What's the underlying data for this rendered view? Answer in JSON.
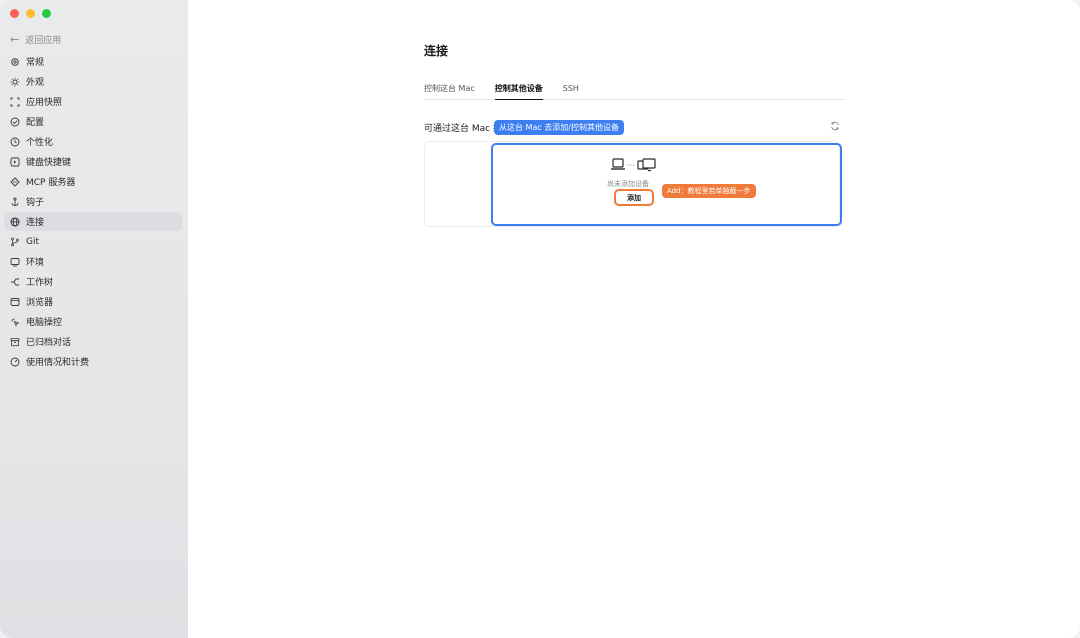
{
  "window": {
    "traffic_lights": {
      "close": "#ff5f57",
      "minimize": "#febc2e",
      "zoom": "#28c840"
    }
  },
  "sidebar": {
    "back_label": "返回应用",
    "items": [
      {
        "label": "常规",
        "icon": "gear-icon"
      },
      {
        "label": "外观",
        "icon": "sun-icon"
      },
      {
        "label": "应用快照",
        "icon": "snapshot-icon"
      },
      {
        "label": "配置",
        "icon": "config-icon"
      },
      {
        "label": "个性化",
        "icon": "personalize-icon"
      },
      {
        "label": "键盘快捷键",
        "icon": "keyboard-icon"
      },
      {
        "label": "MCP 服务器",
        "icon": "server-icon"
      },
      {
        "label": "钩子",
        "icon": "hook-icon"
      },
      {
        "label": "连接",
        "icon": "globe-icon",
        "active": true
      },
      {
        "label": "Git",
        "icon": "git-branch-icon"
      },
      {
        "label": "环境",
        "icon": "environment-icon"
      },
      {
        "label": "工作树",
        "icon": "worktree-icon"
      },
      {
        "label": "浏览器",
        "icon": "browser-icon"
      },
      {
        "label": "电脑操控",
        "icon": "computer-control-icon"
      },
      {
        "label": "已归档对话",
        "icon": "archive-icon"
      },
      {
        "label": "使用情况和计费",
        "icon": "usage-gauge-icon"
      }
    ]
  },
  "main": {
    "title": "连接",
    "tabs": [
      {
        "label": "控制这台 Mac"
      },
      {
        "label": "控制其他设备",
        "active": true
      },
      {
        "label": "SSH"
      }
    ],
    "section_label": "可通过这台 Mac 控",
    "empty_text": "尚未添加设备",
    "add_button": "添加"
  },
  "annotations": {
    "blue_callout": "从这台 Mac 去添加/控制其他设备",
    "orange_callout": "Add：教程里若单独截一步",
    "colors": {
      "blue": "#3d7ef0",
      "orange": "#f07a3a"
    }
  }
}
